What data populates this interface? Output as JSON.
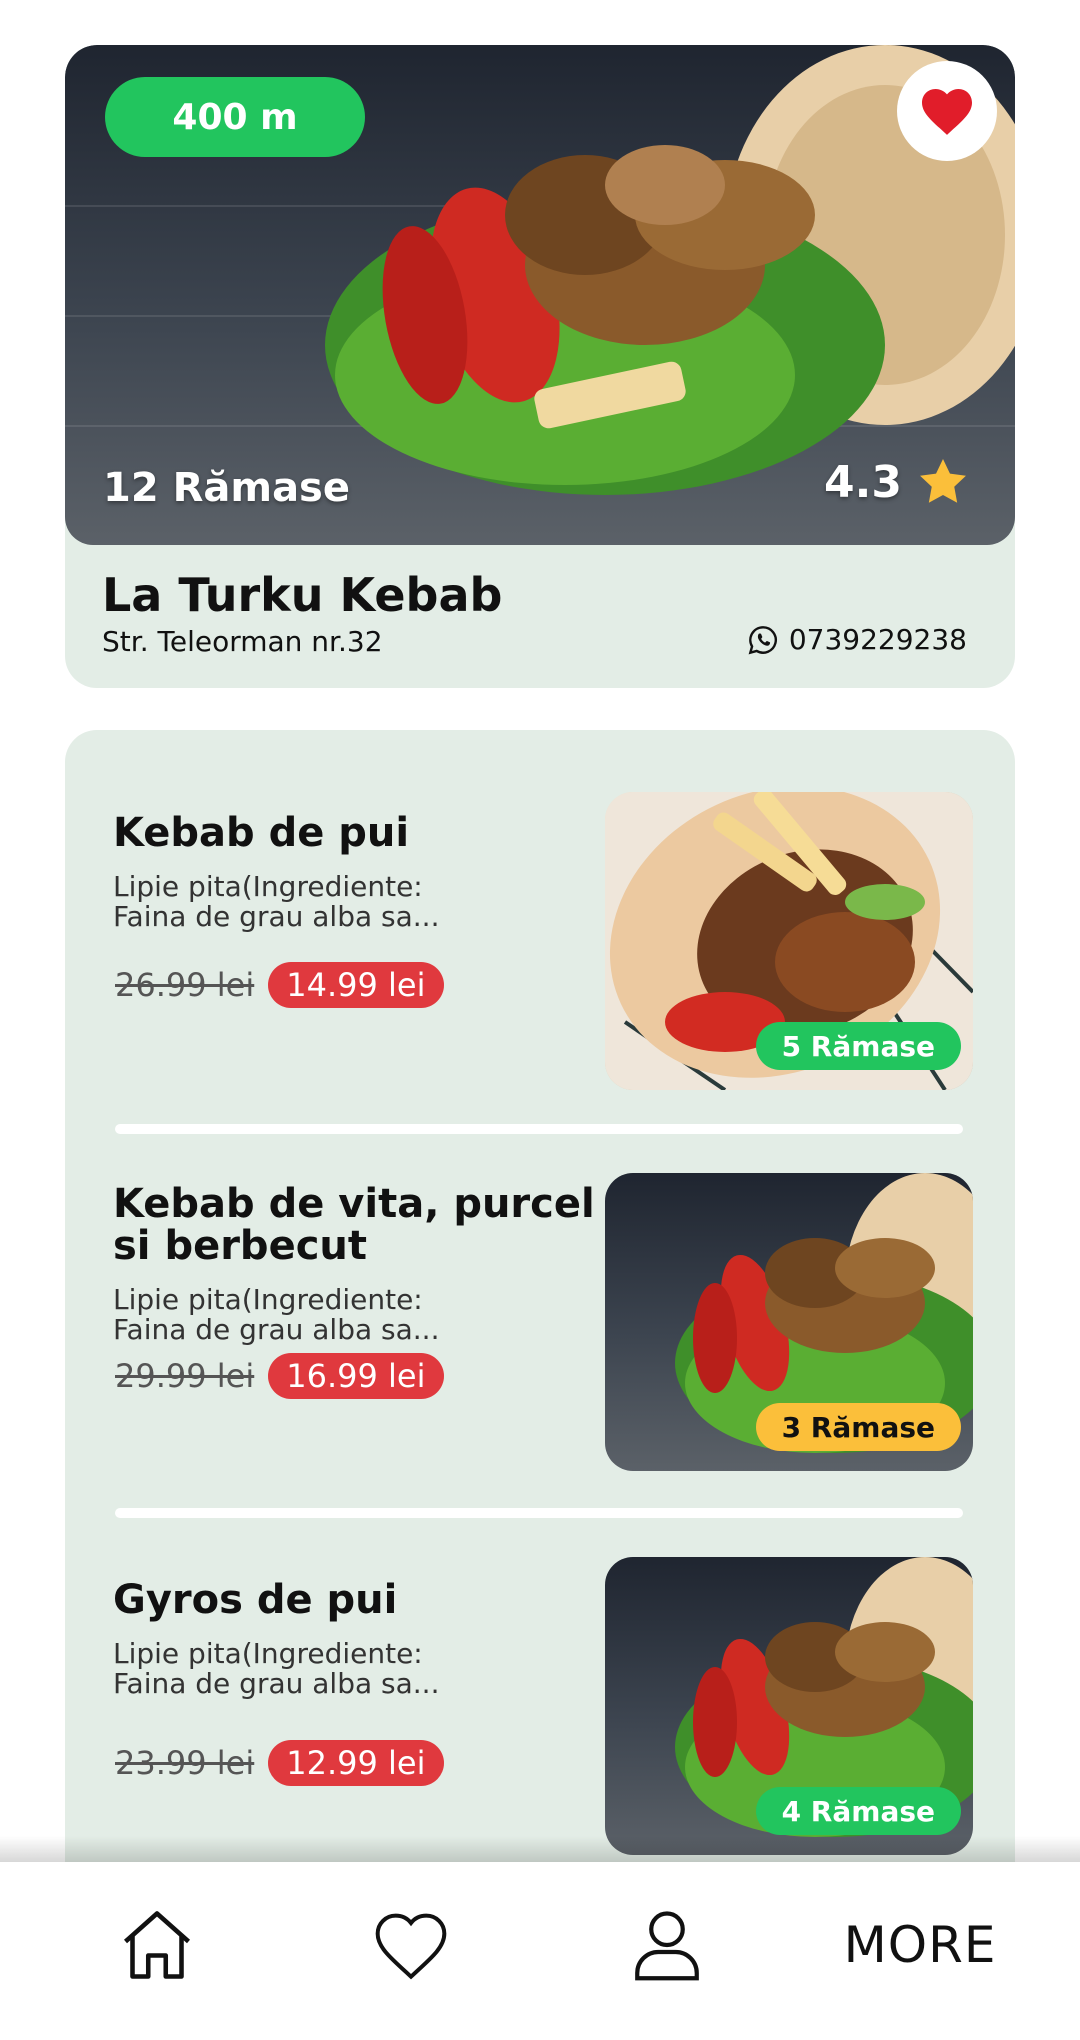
{
  "restaurant": {
    "distance": "400 m",
    "remaining": "12 Rămase",
    "rating": "4.3",
    "name": "La Turku Kebab",
    "address": "Str. Teleorman nr.32",
    "phone": "0739229238",
    "favorite": true
  },
  "menu": {
    "items": [
      {
        "title": "Kebab de pui",
        "description_line1": "Lipie pita(Ingrediente:",
        "description_line2": "Faina de grau alba sa...",
        "old_price": "26.99 lei",
        "new_price": "14.99 lei",
        "stock": "5 Rămase",
        "stock_color": "#22c55e",
        "stock_text_color": "#ffffff"
      },
      {
        "title": "Kebab de vita, purcel si berbecut",
        "description_line1": "Lipie pita(Ingrediente:",
        "description_line2": "Faina de grau alba sa...",
        "old_price": "29.99 lei",
        "new_price": "16.99 lei",
        "stock": "3 Rămase",
        "stock_color": "#fbbf3a",
        "stock_text_color": "#111111"
      },
      {
        "title": "Gyros de pui",
        "description_line1": "Lipie pita(Ingrediente:",
        "description_line2": "Faina de grau alba sa...",
        "old_price": "23.99 lei",
        "new_price": "12.99 lei",
        "stock": "4 Rămase",
        "stock_color": "#22c55e",
        "stock_text_color": "#ffffff"
      }
    ]
  },
  "nav": {
    "items": [
      {
        "icon": "home-icon"
      },
      {
        "icon": "heart-icon"
      },
      {
        "icon": "user-icon"
      },
      {
        "label": "MORE"
      }
    ]
  },
  "colors": {
    "accent_green": "#22c55e",
    "price_red": "#e0393e",
    "card_bg": "#e3ede6",
    "star_yellow": "#fbbf3a"
  }
}
